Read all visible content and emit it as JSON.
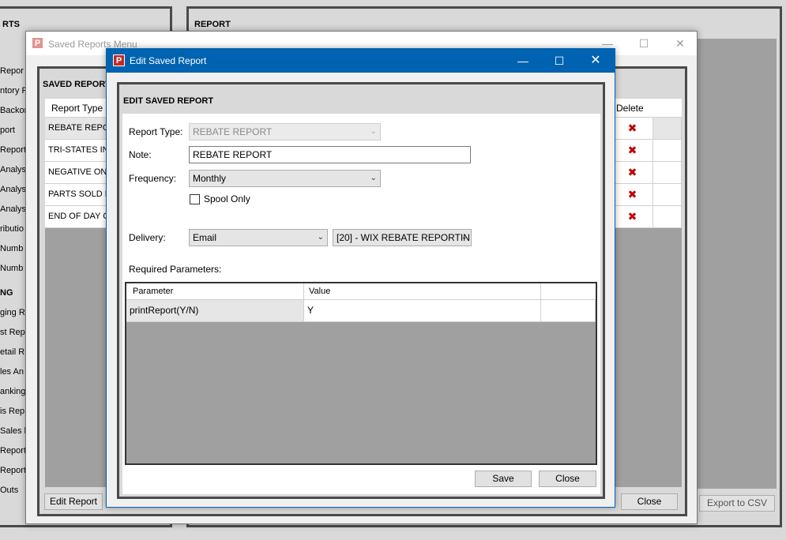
{
  "background": {
    "left_panel_title": "RTS",
    "left_items": [
      "Repor",
      "ntory F",
      "Backor",
      "port",
      "Report",
      "Analys",
      "Analys",
      "Analys",
      "ributio",
      "Numb",
      "Numb"
    ],
    "left_section2": "NG",
    "left_items2": [
      "ging Re",
      "st Repo",
      "etail R",
      "les An",
      "anking",
      "is Rep",
      "Sales b",
      "Report",
      "Report",
      "Outs"
    ],
    "report_panel_title": "REPORT",
    "export_button": "Export to CSV"
  },
  "saved_menu": {
    "window_title": "Saved Reports Menu",
    "section_title": "SAVED REPORTS",
    "col_report_type": "Report Type",
    "col_delete": "Delete",
    "rows": [
      "REBATE REPOR",
      "TRI-STATES INV",
      "NEGATIVE ON-",
      "PARTS SOLD R",
      "END OF DAY C"
    ],
    "edit_button": "Edit Report",
    "close_button": "Close"
  },
  "edit_dialog": {
    "window_title": "Edit Saved Report",
    "section_title": "EDIT SAVED REPORT",
    "report_type_label": "Report Type:",
    "report_type_value": "REBATE REPORT",
    "note_label": "Note:",
    "note_value": "REBATE REPORT",
    "frequency_label": "Frequency:",
    "frequency_value": "Monthly",
    "spool_label": "Spool Only",
    "delivery_label": "Delivery:",
    "delivery_value": "Email",
    "recipient_value": "[20] - WIX REBATE REPORTIN",
    "required_params_label": "Required Parameters:",
    "col_parameter": "Parameter",
    "col_value": "Value",
    "params": [
      {
        "name": "printReport(Y/N)",
        "value": "Y"
      }
    ],
    "save_button": "Save",
    "close_button": "Close"
  },
  "colors": {
    "titlebar_active": "#0063b1",
    "grid_gray": "#a0a0a0",
    "delete_red": "#c00000"
  }
}
